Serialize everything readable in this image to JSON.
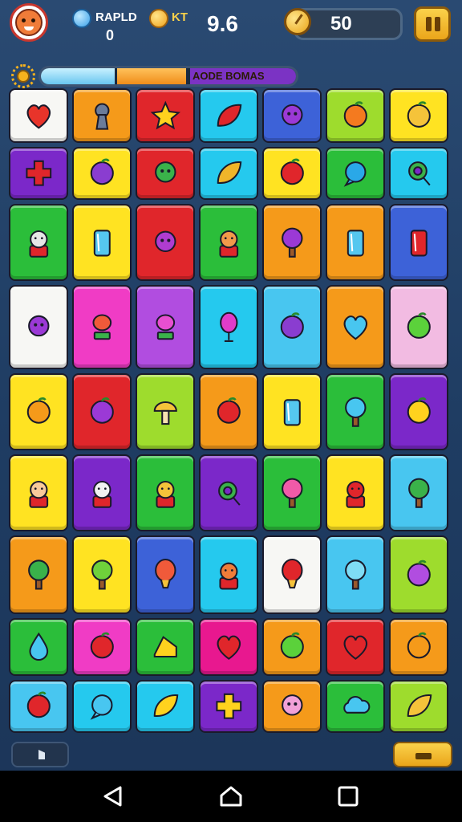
{
  "header": {
    "gem_label": "RAPLD",
    "gem_value": "0",
    "coin_label": "KT",
    "score": "9.6",
    "timer": "50"
  },
  "bonus_bar": {
    "label": "AODE BOMAS",
    "blue_fill_fraction": 0.3,
    "orange_fill_fraction": 0.27
  },
  "colors": {
    "white": "#f7f7f4",
    "orange": "#f59a1a",
    "red": "#e0262b",
    "cyan": "#25c9ee",
    "blue": "#3d62d8",
    "lime": "#9edc2d",
    "yellow": "#ffe322",
    "purple": "#7b28c9",
    "green": "#2bbe3a",
    "pink": "#f03cc5",
    "lavender": "#b14de0",
    "lightpink": "#f2bbe2",
    "skyblue": "#48c6f0",
    "magenta": "#e8188f"
  },
  "grid": {
    "rows": [
      {
        "h": 68,
        "tiles": [
          {
            "bg": "white",
            "icon": "heart-icon",
            "c": "#e8342a"
          },
          {
            "bg": "orange",
            "icon": "keyhole-icon",
            "c": "#6b7c9a"
          },
          {
            "bg": "red",
            "icon": "star-icon",
            "c": "#ffd21e"
          },
          {
            "bg": "cyan",
            "icon": "chili-icon",
            "c": "#e0262b"
          },
          {
            "bg": "blue",
            "icon": "gear-flower-icon",
            "c": "#9b39d6"
          },
          {
            "bg": "lime",
            "icon": "peach-icon",
            "c": "#f47a1f"
          },
          {
            "bg": "yellow",
            "icon": "bird-icon",
            "c": "#f5c33a"
          }
        ]
      },
      {
        "h": 66,
        "tiles": [
          {
            "bg": "purple",
            "icon": "cross-icon",
            "c": "#e0262b"
          },
          {
            "bg": "yellow",
            "icon": "onion-icon",
            "c": "#8a3dd0"
          },
          {
            "bg": "red",
            "icon": "monster-icon",
            "c": "#3ab24a"
          },
          {
            "bg": "cyan",
            "icon": "shell-icon",
            "c": "#f0b52a"
          },
          {
            "bg": "yellow",
            "icon": "strawberry-icon",
            "c": "#e0262b"
          },
          {
            "bg": "green",
            "icon": "bubble-icon",
            "c": "#2aa8e8"
          },
          {
            "bg": "cyan",
            "icon": "magnifier-icon",
            "c": "#3ab24a"
          }
        ]
      },
      {
        "h": 96,
        "tiles": [
          {
            "bg": "green",
            "icon": "robot-face-icon",
            "c": "#e6e6e6"
          },
          {
            "bg": "yellow",
            "icon": "vase-icon",
            "c": "#55c7ef"
          },
          {
            "bg": "red",
            "icon": "cookie-icon",
            "c": "#b03cd0"
          },
          {
            "bg": "green",
            "icon": "boy-face-icon",
            "c": "#f09a4a"
          },
          {
            "bg": "orange",
            "icon": "purple-tree-icon",
            "c": "#9b39d6"
          },
          {
            "bg": "orange",
            "icon": "glass-icon",
            "c": "#55c7ef"
          },
          {
            "bg": "blue",
            "icon": "jar-icon",
            "c": "#e0262b"
          }
        ]
      },
      {
        "h": 105,
        "tiles": [
          {
            "bg": "white",
            "icon": "blob-icon",
            "c": "#9b39d6"
          },
          {
            "bg": "pink",
            "icon": "flower-pot-icon",
            "c": "#f05a3a"
          },
          {
            "bg": "lavender",
            "icon": "potion-icon",
            "c": "#e84fd0"
          },
          {
            "bg": "cyan",
            "icon": "balloon-icon",
            "c": "#e03cc9"
          },
          {
            "bg": "skyblue",
            "icon": "plum-icon",
            "c": "#8a3dd0"
          },
          {
            "bg": "orange",
            "icon": "heart-gem-icon",
            "c": "#48c6f0"
          },
          {
            "bg": "lightpink",
            "icon": "apple-icon",
            "c": "#5bd13b"
          }
        ]
      },
      {
        "h": 96,
        "tiles": [
          {
            "bg": "yellow",
            "icon": "orange-fruit-icon",
            "c": "#f59a1a"
          },
          {
            "bg": "red",
            "icon": "berry-icon",
            "c": "#9b39d6"
          },
          {
            "bg": "lime",
            "icon": "mushroom-icon",
            "c": "#f5c33a"
          },
          {
            "bg": "orange",
            "icon": "cherry-icon",
            "c": "#e0262b"
          },
          {
            "bg": "yellow",
            "icon": "cup-icon",
            "c": "#55c7ef"
          },
          {
            "bg": "green",
            "icon": "blue-tree-icon",
            "c": "#48c6f0"
          },
          {
            "bg": "purple",
            "icon": "lemon-icon",
            "c": "#ffd21e"
          }
        ]
      },
      {
        "h": 96,
        "tiles": [
          {
            "bg": "yellow",
            "icon": "farmer-icon",
            "c": "#f7c99a"
          },
          {
            "bg": "purple",
            "icon": "ghost-kid-icon",
            "c": "#f2f2f2"
          },
          {
            "bg": "green",
            "icon": "cowboy-icon",
            "c": "#f5c33a"
          },
          {
            "bg": "purple",
            "icon": "magnifier-icon",
            "c": "#3ab24a"
          },
          {
            "bg": "green",
            "icon": "pink-tree-icon",
            "c": "#f05aa8"
          },
          {
            "bg": "yellow",
            "icon": "cat-icon",
            "c": "#e0262b"
          },
          {
            "bg": "skyblue",
            "icon": "green-tree-icon",
            "c": "#3ab24a"
          }
        ]
      },
      {
        "h": 98,
        "tiles": [
          {
            "bg": "orange",
            "icon": "green-tree-icon",
            "c": "#3ab24a"
          },
          {
            "bg": "yellow",
            "icon": "green-tree-icon",
            "c": "#6fd13b"
          },
          {
            "bg": "blue",
            "icon": "hot-air-balloon-icon",
            "c": "#f05a3a"
          },
          {
            "bg": "cyan",
            "icon": "fox-icon",
            "c": "#f07c39"
          },
          {
            "bg": "white",
            "icon": "hot-air-balloon-icon",
            "c": "#e0262b"
          },
          {
            "bg": "skyblue",
            "icon": "blue-tree-icon",
            "c": "#7fdcf5"
          },
          {
            "bg": "lime",
            "icon": "egg-icon",
            "c": "#b14de0"
          }
        ]
      },
      {
        "h": 72,
        "tiles": [
          {
            "bg": "green",
            "icon": "drop-icon",
            "c": "#48c6f0"
          },
          {
            "bg": "pink",
            "icon": "strawberry-icon",
            "c": "#e0262b"
          },
          {
            "bg": "green",
            "icon": "cheese-icon",
            "c": "#ffd21e"
          },
          {
            "bg": "magenta",
            "icon": "heart-icon",
            "c": "#e0262b"
          },
          {
            "bg": "orange",
            "icon": "melon-icon",
            "c": "#5bd13b"
          },
          {
            "bg": "red",
            "icon": "heart-icon",
            "c": "#e0262b"
          },
          {
            "bg": "orange",
            "icon": "pumpkin-icon",
            "c": "#f59a1a"
          }
        ]
      },
      {
        "h": 66,
        "tiles": [
          {
            "bg": "skyblue",
            "icon": "cherry-icon",
            "c": "#e0262b"
          },
          {
            "bg": "cyan",
            "icon": "speech-bubble-icon",
            "c": "#48c6f0"
          },
          {
            "bg": "cyan",
            "icon": "leaf-icon",
            "c": "#ffd21e"
          },
          {
            "bg": "purple",
            "icon": "cross-icon",
            "c": "#ffd21e"
          },
          {
            "bg": "orange",
            "icon": "octopus-icon",
            "c": "#f2a1d8"
          },
          {
            "bg": "green",
            "icon": "cloud-icon",
            "c": "#48c6f0"
          },
          {
            "bg": "lime",
            "icon": "shell-icon",
            "c": "#f5c33a"
          }
        ]
      }
    ]
  }
}
